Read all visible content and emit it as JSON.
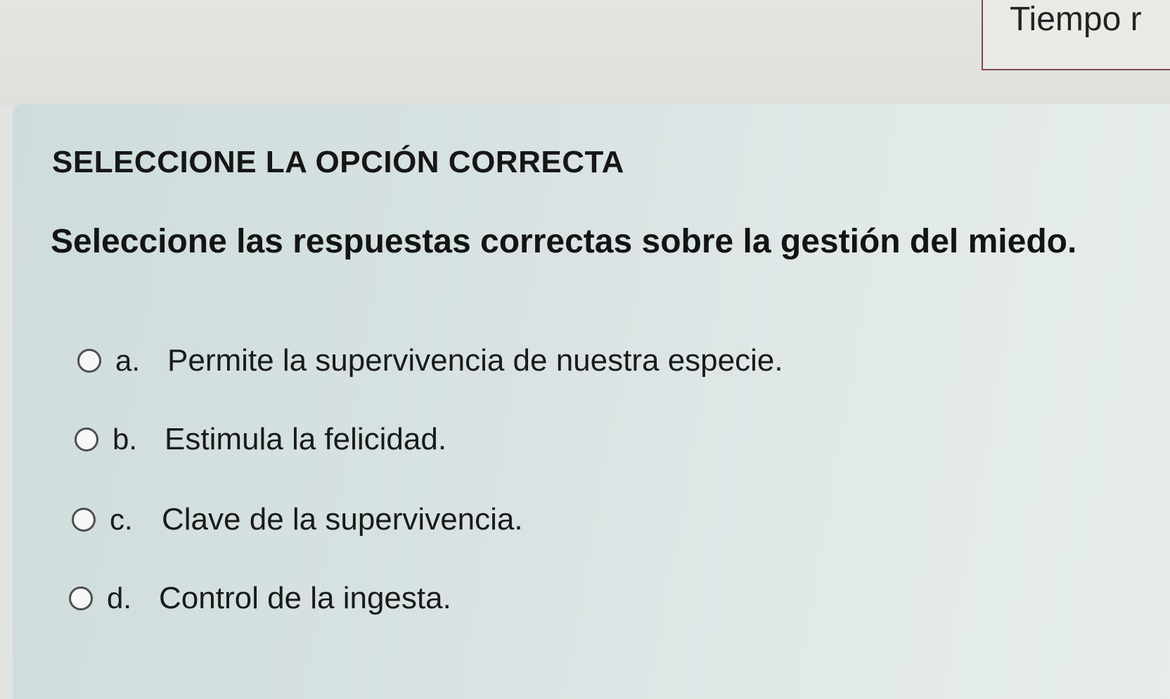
{
  "timer": {
    "label": "Tiempo r"
  },
  "question": {
    "instruction": "SELECCIONE LA OPCIÓN CORRECTA",
    "text": "Seleccione las respuestas correctas sobre la gestión del miedo.",
    "options": [
      {
        "letter": "a.",
        "text": "Permite la supervivencia de nuestra especie.",
        "selected": false
      },
      {
        "letter": "b.",
        "text": "Estimula la felicidad.",
        "selected": false
      },
      {
        "letter": "c.",
        "text": "Clave de la supervivencia.",
        "selected": false
      },
      {
        "letter": "d.",
        "text": "Control de la ingesta.",
        "selected": false
      }
    ]
  }
}
